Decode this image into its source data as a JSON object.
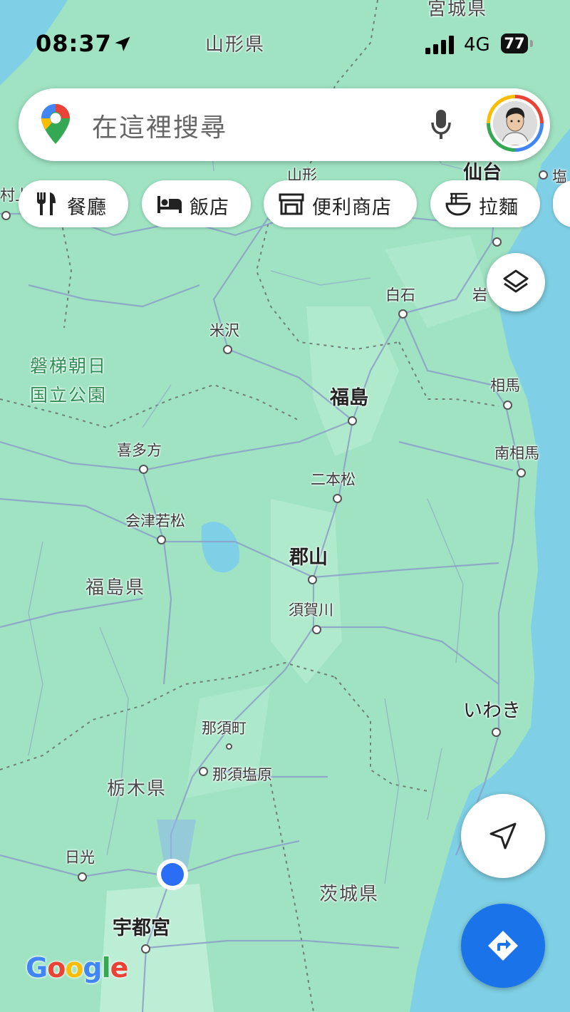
{
  "status_bar": {
    "time": "08:37",
    "network": "4G",
    "battery": "77"
  },
  "search": {
    "placeholder": "在這裡搜尋"
  },
  "chips": [
    {
      "icon": "restaurant-icon",
      "label": "餐廳"
    },
    {
      "icon": "hotel-icon",
      "label": "飯店"
    },
    {
      "icon": "convenience-store-icon",
      "label": "便利商店"
    },
    {
      "icon": "ramen-icon",
      "label": "拉麵"
    }
  ],
  "map_labels": {
    "miyagi_pref": "宮城県",
    "yamagata_pref": "山形県",
    "sendai": "仙台",
    "shiogama": "塩",
    "murakami": "村上",
    "yamagata_partial": "山形",
    "shiroishi": "白石",
    "iwanuma": "岩",
    "yonezawa": "米沢",
    "park": "磐梯朝日\n国立公園",
    "fukushima": "福島",
    "soma": "相馬",
    "kitakata": "喜多方",
    "minamisoma": "南相馬",
    "nihonmatsu": "二本松",
    "aizuwakamatsu": "会津若松",
    "koriyama": "郡山",
    "fukushima_pref": "福島県",
    "sukagawa": "須賀川",
    "iwaki": "いわき",
    "nasu": "那須町",
    "nasushiobara": "那須塩原",
    "tochigi_pref": "栃木県",
    "nikko": "日光",
    "ibaraki_pref": "茨城県",
    "utsunomiya": "宇都宮"
  },
  "map_buttons": {
    "layers": "layers-icon",
    "my_location": "navigation-arrow-icon",
    "directions": "directions-icon"
  },
  "brand": {
    "logo_text": "Google"
  },
  "colors": {
    "land": "#9fe3c3",
    "sea": "#7fd0e6",
    "accent_blue": "#1a73e8",
    "location_dot": "#2b6ef5"
  }
}
